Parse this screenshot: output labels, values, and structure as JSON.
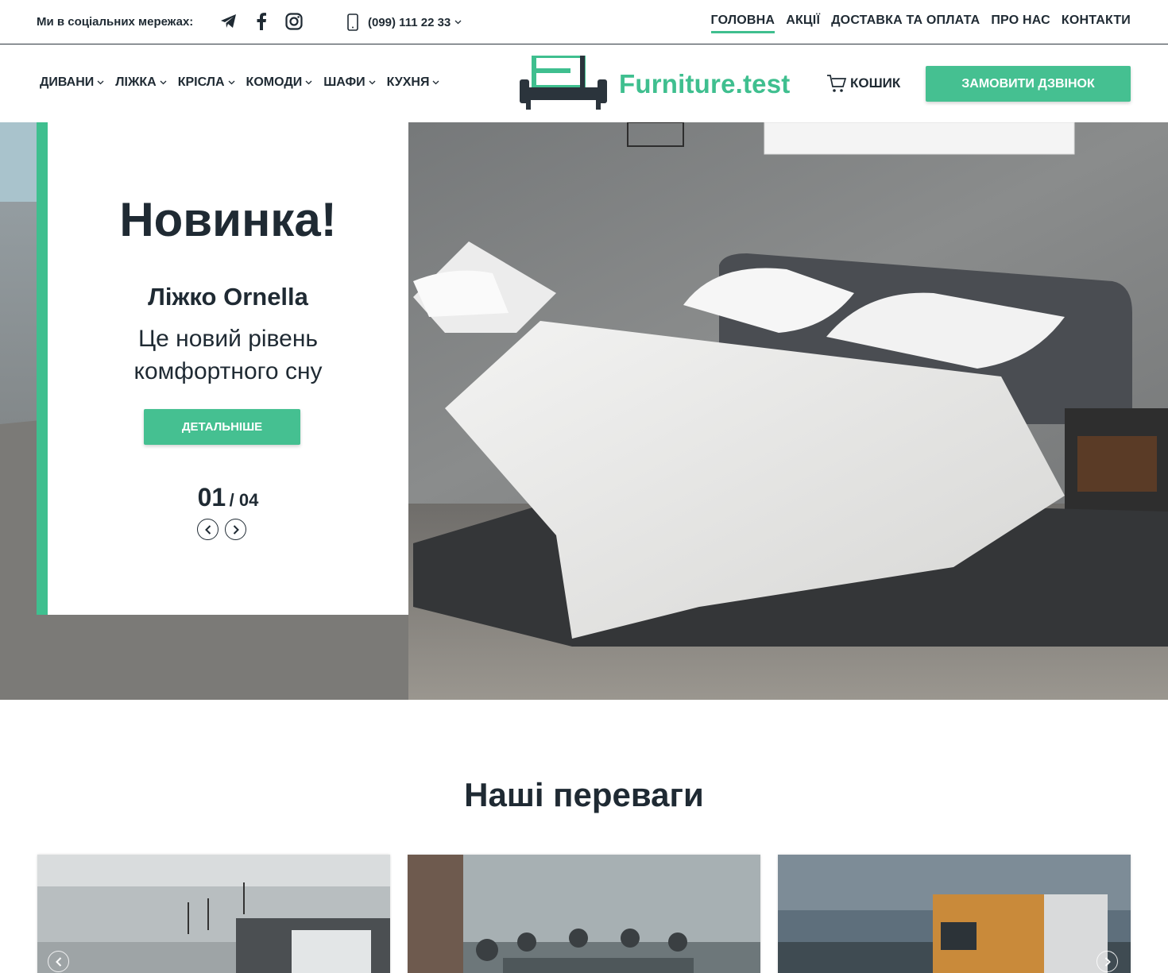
{
  "topbar": {
    "social_label": "Ми в соціальних мережах:",
    "social_icons": [
      "telegram-icon",
      "facebook-icon",
      "instagram-icon"
    ],
    "phone": "(099) 111 22 33",
    "nav": [
      {
        "label": "ГОЛОВНА",
        "active": true
      },
      {
        "label": "АКЦІЇ",
        "active": false
      },
      {
        "label": "ДОСТАВКА ТА ОПЛАТА",
        "active": false
      },
      {
        "label": "ПРО НАС",
        "active": false
      },
      {
        "label": "КОНТАКТИ",
        "active": false
      }
    ]
  },
  "header": {
    "categories": [
      "ДИВАНИ",
      "ЛІЖКА",
      "КРІСЛА",
      "КОМОДИ",
      "ШАФИ",
      "КУХНЯ"
    ],
    "logo_text": "Furniture.test",
    "cart_label": "КОШИК",
    "call_button": "ЗАМОВИТИ ДЗВІНОК"
  },
  "hero": {
    "badge": "Новинка!",
    "product": "Ліжко Ornella",
    "tagline": "Це новий рівень комфортного сну",
    "button": "ДЕТАЛЬНІШЕ",
    "current_slide": "01",
    "total_slides": "/ 04"
  },
  "advantages": {
    "title": "Наші переваги"
  },
  "colors": {
    "accent": "#3fbf8f",
    "text": "#1f2a33",
    "button": "#45c091"
  }
}
